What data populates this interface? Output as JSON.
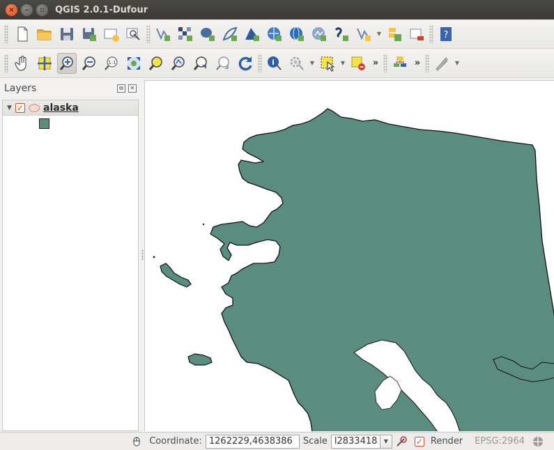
{
  "window": {
    "title": "QGIS 2.0.1-Dufour"
  },
  "toolbar_file": {
    "icons": [
      "new-project-icon",
      "open-project-icon",
      "save-project-icon",
      "save-as-icon",
      "new-print-composer-icon",
      "composer-manager-icon",
      "add-vector-layer-icon",
      "add-raster-layer-icon",
      "add-postgis-layer-icon",
      "add-spatialite-layer-icon",
      "add-wms-layer-icon",
      "add-wcs-layer-icon",
      "add-wfs-layer-icon",
      "add-delimited-text-icon",
      "add-gps-icon",
      "add-virtual-layer-icon",
      "new-layer-icon",
      "remove-layer-icon",
      "help-icon"
    ]
  },
  "toolbar_map": {
    "icons": [
      "pan-icon",
      "pan-to-selection-icon",
      "zoom-in-icon",
      "zoom-out-icon",
      "zoom-actual-icon",
      "zoom-full-icon",
      "zoom-selection-icon",
      "zoom-layer-icon",
      "zoom-last-icon",
      "zoom-next-icon",
      "refresh-icon",
      "identify-icon",
      "actions-icon",
      "select-icon",
      "deselect-icon"
    ]
  },
  "layers_panel": {
    "title": "Layers",
    "layers": [
      {
        "name": "alaska",
        "visible": true,
        "fill_color": "#5a8c80"
      }
    ]
  },
  "map": {
    "fill_color": "#5a8c80",
    "stroke_color": "#111111",
    "background": "#ffffff"
  },
  "statusbar": {
    "coordinate_label": "Coordinate:",
    "coordinate_value": "1262229,4638386",
    "scale_label": "Scale",
    "scale_value": "l2833418",
    "render_label": "Render",
    "render_checked": true,
    "crs": "EPSG:2964"
  }
}
